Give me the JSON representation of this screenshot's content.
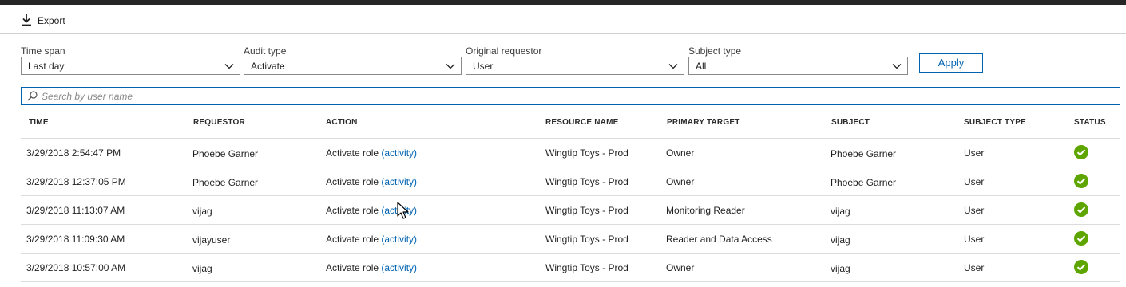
{
  "toolbar": {
    "export_label": "Export"
  },
  "filters": {
    "time_span": {
      "label": "Time span",
      "value": "Last day"
    },
    "audit_type": {
      "label": "Audit type",
      "value": "Activate"
    },
    "original_requestor": {
      "label": "Original requestor",
      "value": "User"
    },
    "subject_type": {
      "label": "Subject type",
      "value": "All"
    },
    "apply_label": "Apply"
  },
  "search": {
    "placeholder": "Search by user name",
    "value": ""
  },
  "table": {
    "headers": {
      "time": "TIME",
      "requestor": "REQUESTOR",
      "action": "ACTION",
      "resource_name": "RESOURCE NAME",
      "primary_target": "PRIMARY TARGET",
      "subject": "SUBJECT",
      "subject_type": "SUBJECT TYPE",
      "status": "STATUS"
    },
    "rows": [
      {
        "time": "3/29/2018 2:54:47 PM",
        "requestor": "Phoebe Garner",
        "action": "Activate role",
        "action_link": "(activity)",
        "resource_name": "Wingtip Toys - Prod",
        "primary_target": "Owner",
        "subject": "Phoebe Garner",
        "subject_type": "User",
        "status": "success"
      },
      {
        "time": "3/29/2018 12:37:05 PM",
        "requestor": "Phoebe Garner",
        "action": "Activate role",
        "action_link": "(activity)",
        "resource_name": "Wingtip Toys - Prod",
        "primary_target": "Owner",
        "subject": "Phoebe Garner",
        "subject_type": "User",
        "status": "success"
      },
      {
        "time": "3/29/2018 11:13:07 AM",
        "requestor": "vijag",
        "action": "Activate role",
        "action_link": "(activity)",
        "resource_name": "Wingtip Toys - Prod",
        "primary_target": "Monitoring Reader",
        "subject": "vijag",
        "subject_type": "User",
        "status": "success"
      },
      {
        "time": "3/29/2018 11:09:30 AM",
        "requestor": "vijayuser",
        "action": "Activate role",
        "action_link": "(activity)",
        "resource_name": "Wingtip Toys - Prod",
        "primary_target": "Reader and Data Access",
        "subject": "vijag",
        "subject_type": "User",
        "status": "success"
      },
      {
        "time": "3/29/2018 10:57:00 AM",
        "requestor": "vijag",
        "action": "Activate role",
        "action_link": "(activity)",
        "resource_name": "Wingtip Toys - Prod",
        "primary_target": "Owner",
        "subject": "vijag",
        "subject_type": "User",
        "status": "success"
      }
    ]
  },
  "colors": {
    "accent": "#0063b1",
    "success": "#5ea500",
    "topbar": "#262626"
  },
  "icons": {
    "export": "download-icon",
    "dropdown": "chevron-down-icon",
    "search": "search-icon",
    "status_success": "check-circle-icon"
  }
}
